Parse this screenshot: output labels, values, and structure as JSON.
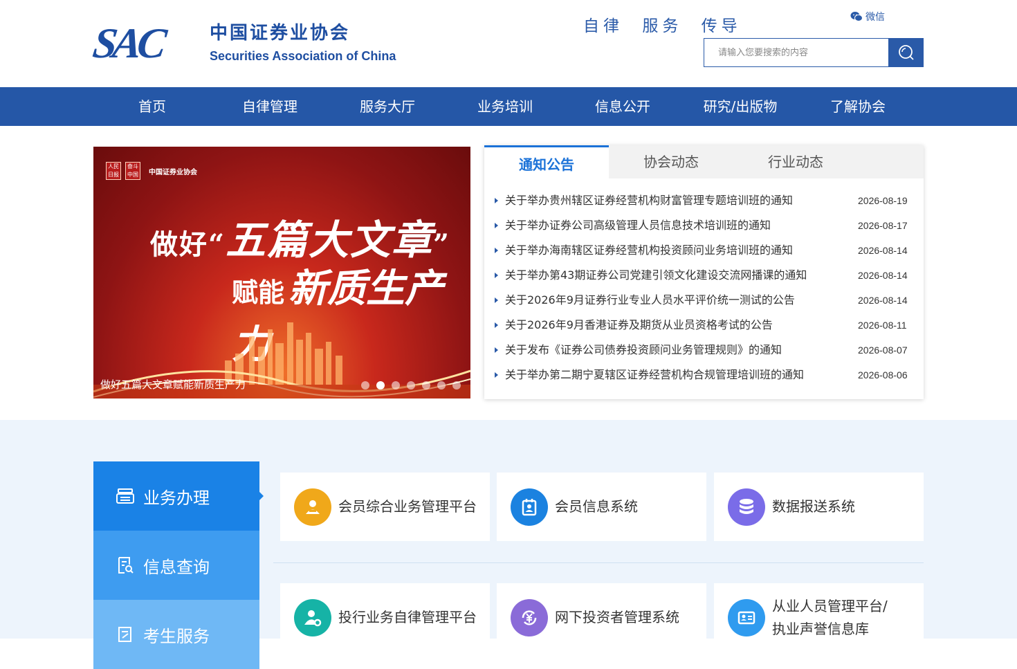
{
  "header": {
    "logo_abbr": "SAC",
    "logo_cn": "中国证券业协会",
    "logo_en": "Securities Association of China",
    "slogan": [
      "自律",
      "服务",
      "传导"
    ],
    "wechat_label": "微信",
    "search_placeholder": "请输入您要搜索的内容"
  },
  "nav": [
    "首页",
    "自律管理",
    "服务大厅",
    "业务培训",
    "信息公开",
    "研究/出版物",
    "了解协会"
  ],
  "banner": {
    "seal_1": "人民日报",
    "seal_2": "奋斗中国",
    "org": "中国证券业协会",
    "headline_1_pre": "做好“",
    "headline_1_big": "五篇大文章",
    "headline_1_post": "”",
    "headline_2_pre": "赋能",
    "headline_2_big": "新质生产力",
    "caption": "做好五篇大文章赋能新质生产力",
    "slide_count": 7,
    "active_slide": 2
  },
  "news": {
    "tabs": [
      "通知公告",
      "协会动态",
      "行业动态"
    ],
    "active_tab": 0,
    "items": [
      {
        "title": "关于举办贵州辖区证券经营机构财富管理专题培训班的通知",
        "date": "2026-08-19"
      },
      {
        "title": "关于举办证券公司高级管理人员信息技术培训班的通知",
        "date": "2026-08-17"
      },
      {
        "title": "关于举办海南辖区证券经营机构投资顾问业务培训班的通知",
        "date": "2026-08-14"
      },
      {
        "title": "关于举办第43期证券公司党建引领文化建设交流网播课的通知",
        "date": "2026-08-14"
      },
      {
        "title": "关于2026年9月证券行业专业人员水平评价统一测试的公告",
        "date": "2026-08-14"
      },
      {
        "title": "关于2026年9月香港证券及期货从业员资格考试的公告",
        "date": "2026-08-11"
      },
      {
        "title": "关于发布《证券公司债券投资顾问业务管理规则》的通知",
        "date": "2026-08-07"
      },
      {
        "title": "关于举办第二期宁夏辖区证券经营机构合规管理培训班的通知",
        "date": "2026-08-06"
      }
    ]
  },
  "services": {
    "side_tabs": [
      "业务办理",
      "信息查询",
      "考生服务"
    ],
    "cards": [
      {
        "label": "会员综合业务管理平台",
        "color": "#f0a81a",
        "icon": "user-card-icon"
      },
      {
        "label": "会员信息系统",
        "color": "#1b82e0",
        "icon": "id-badge-icon"
      },
      {
        "label": "数据报送系统",
        "color": "#7a6ce8",
        "icon": "database-icon"
      },
      {
        "label": "投行业务自律管理平台",
        "color": "#16b3a6",
        "icon": "user-gear-icon"
      },
      {
        "label": "网下投资者管理系统",
        "color": "#8a6bd8",
        "icon": "yuan-cycle-icon"
      },
      {
        "label_1": "从业人员管理平台/",
        "label_2": "执业声誉信息库",
        "color": "#2f9bef",
        "icon": "id-card-icon"
      }
    ]
  }
}
